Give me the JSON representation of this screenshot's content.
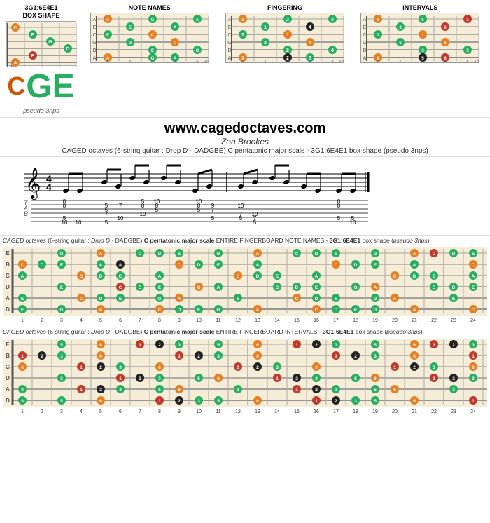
{
  "header": {
    "box_shape_line1": "3G1:6E4E1",
    "box_shape_line2": "BOX SHAPE",
    "pseudo_label": "pseudo 3nps",
    "logo_c": "C",
    "logo_ge": "GE",
    "panels": [
      {
        "label": "NOTE NAMES"
      },
      {
        "label": "FINGERING"
      },
      {
        "label": "INTERVALS"
      }
    ]
  },
  "title_section": {
    "website": "www.cagedoctaves.com",
    "author": "Zon Brookes",
    "description": "CAGED octaves (6-string guitar : Drop D - DADGBE) C pentatonic major scale - 3G1:6E4E1 box shape (pseudo 3nps)"
  },
  "fingerboard_note_names": {
    "title_prefix": "CAGED octaves",
    "title_guitar": "(6-string guitar : Drop D - DADGBE)",
    "title_scale": "C pentatonic major scale",
    "title_suffix": "ENTIRE FINGERBOARD NOTE NAMES -",
    "title_box": "3G1:6E4E1",
    "title_end": "box shape (pseudo 3nps)",
    "strings": [
      "E",
      "B",
      "G",
      "D",
      "A",
      "D"
    ],
    "fret_numbers": [
      1,
      2,
      3,
      4,
      5,
      6,
      7,
      8,
      9,
      10,
      11,
      12,
      13,
      14,
      15,
      16,
      17,
      18,
      19,
      20,
      21,
      22,
      23,
      24
    ]
  },
  "fingerboard_intervals": {
    "title_prefix": "CAGED octaves",
    "title_guitar": "(6-string guitar : Drop D - DADGBE)",
    "title_scale": "C pentatonic major scale",
    "title_suffix": "ENTIRE FINGERBOARD INTERVALS -",
    "title_box": "3G1:6E4E1",
    "title_end": "box shape (pseudo 3nps)",
    "strings": [
      "E",
      "B",
      "G",
      "D",
      "A",
      "D"
    ]
  },
  "colors": {
    "orange": "#e67e22",
    "green": "#27ae60",
    "red": "#c0392b",
    "dark": "#222222",
    "blue": "#2980b9",
    "lime": "#7dba00"
  }
}
